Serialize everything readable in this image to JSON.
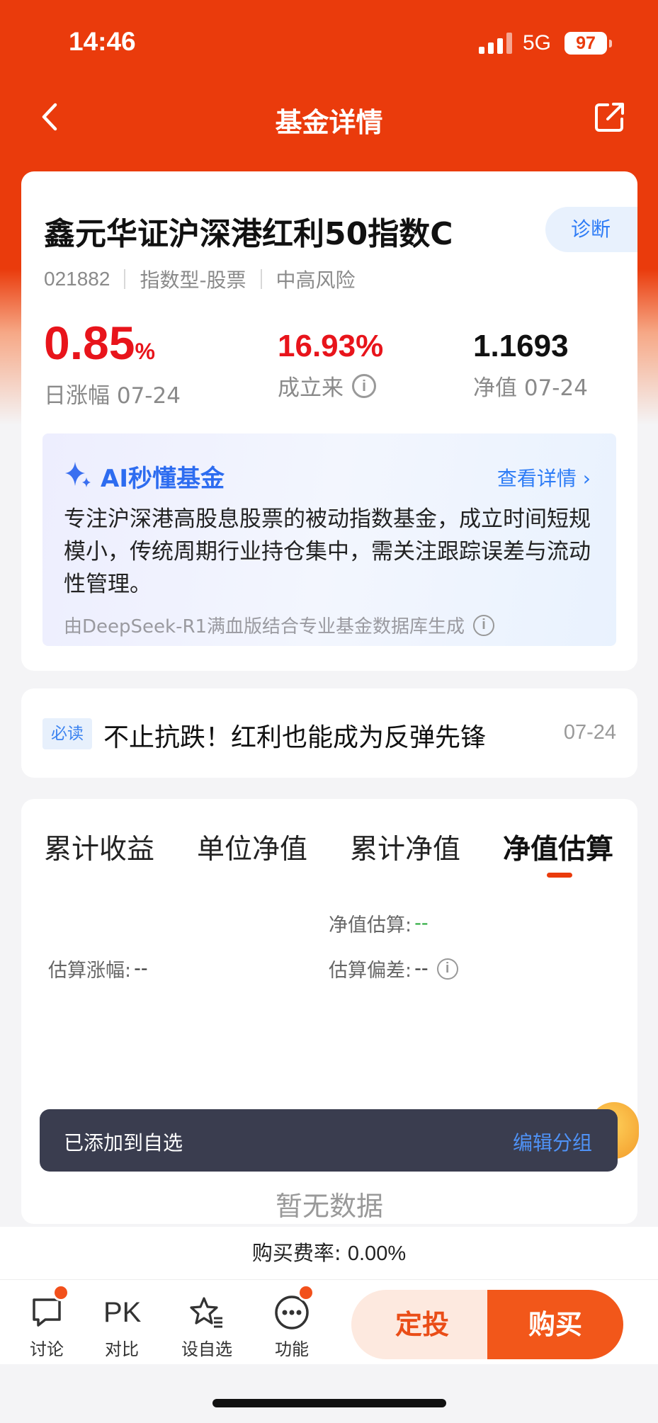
{
  "status_bar": {
    "time": "14:46",
    "network": "5G",
    "battery": "97"
  },
  "nav": {
    "title": "基金详情"
  },
  "fund": {
    "name": "鑫元华证沪深港红利50指数C",
    "diagnose_label": "诊断",
    "code": "021882",
    "type": "指数型-股票",
    "risk": "中高风险",
    "daily_change": "0.85",
    "daily_change_unit": "%",
    "daily_change_label": "日涨幅 07-24",
    "since_inception": "16.93%",
    "since_inception_label": "成立来",
    "nav_value": "1.1693",
    "nav_label": "净值 07-24",
    "colors": {
      "up": "#e8141b",
      "text": "#111111"
    }
  },
  "ai": {
    "title": "AI秒懂基金",
    "link": "查看详情 ›",
    "body": "专注沪深港高股息股票的被动指数基金，成立时间短规模小，传统周期行业持仓集中，需关注跟踪误差与流动性管理。",
    "source": "由DeepSeek-R1满血版结合专业基金数据库生成"
  },
  "news": {
    "tag": "必读",
    "title": "不止抗跌！红利也能成为反弹先锋",
    "date": "07-24"
  },
  "chart_tabs": {
    "tabs": [
      "累计收益",
      "单位净值",
      "累计净值",
      "净值估算"
    ],
    "active_index": 3
  },
  "estimate": {
    "nav_est_label": "净值估算:",
    "nav_est_value": "--",
    "change_label": "估算涨幅:",
    "change_value": "--",
    "deviation_label": "估算偏差:",
    "deviation_value": "--",
    "no_data": "暂无数据"
  },
  "toast": {
    "message": "已添加到自选",
    "action": "编辑分组"
  },
  "fee": {
    "label": "购买费率:",
    "value": "0.00%"
  },
  "bottom_bar": {
    "items": [
      {
        "label": "讨论",
        "icon": "chat-bubble-icon",
        "dot": true
      },
      {
        "label": "对比",
        "icon": "pk-icon",
        "icon_text": "PK",
        "dot": false
      },
      {
        "label": "设自选",
        "icon": "star-list-icon",
        "dot": false
      },
      {
        "label": "功能",
        "icon": "more-dots-icon",
        "dot": true
      }
    ],
    "sip_button": "定投",
    "buy_button": "购买"
  }
}
